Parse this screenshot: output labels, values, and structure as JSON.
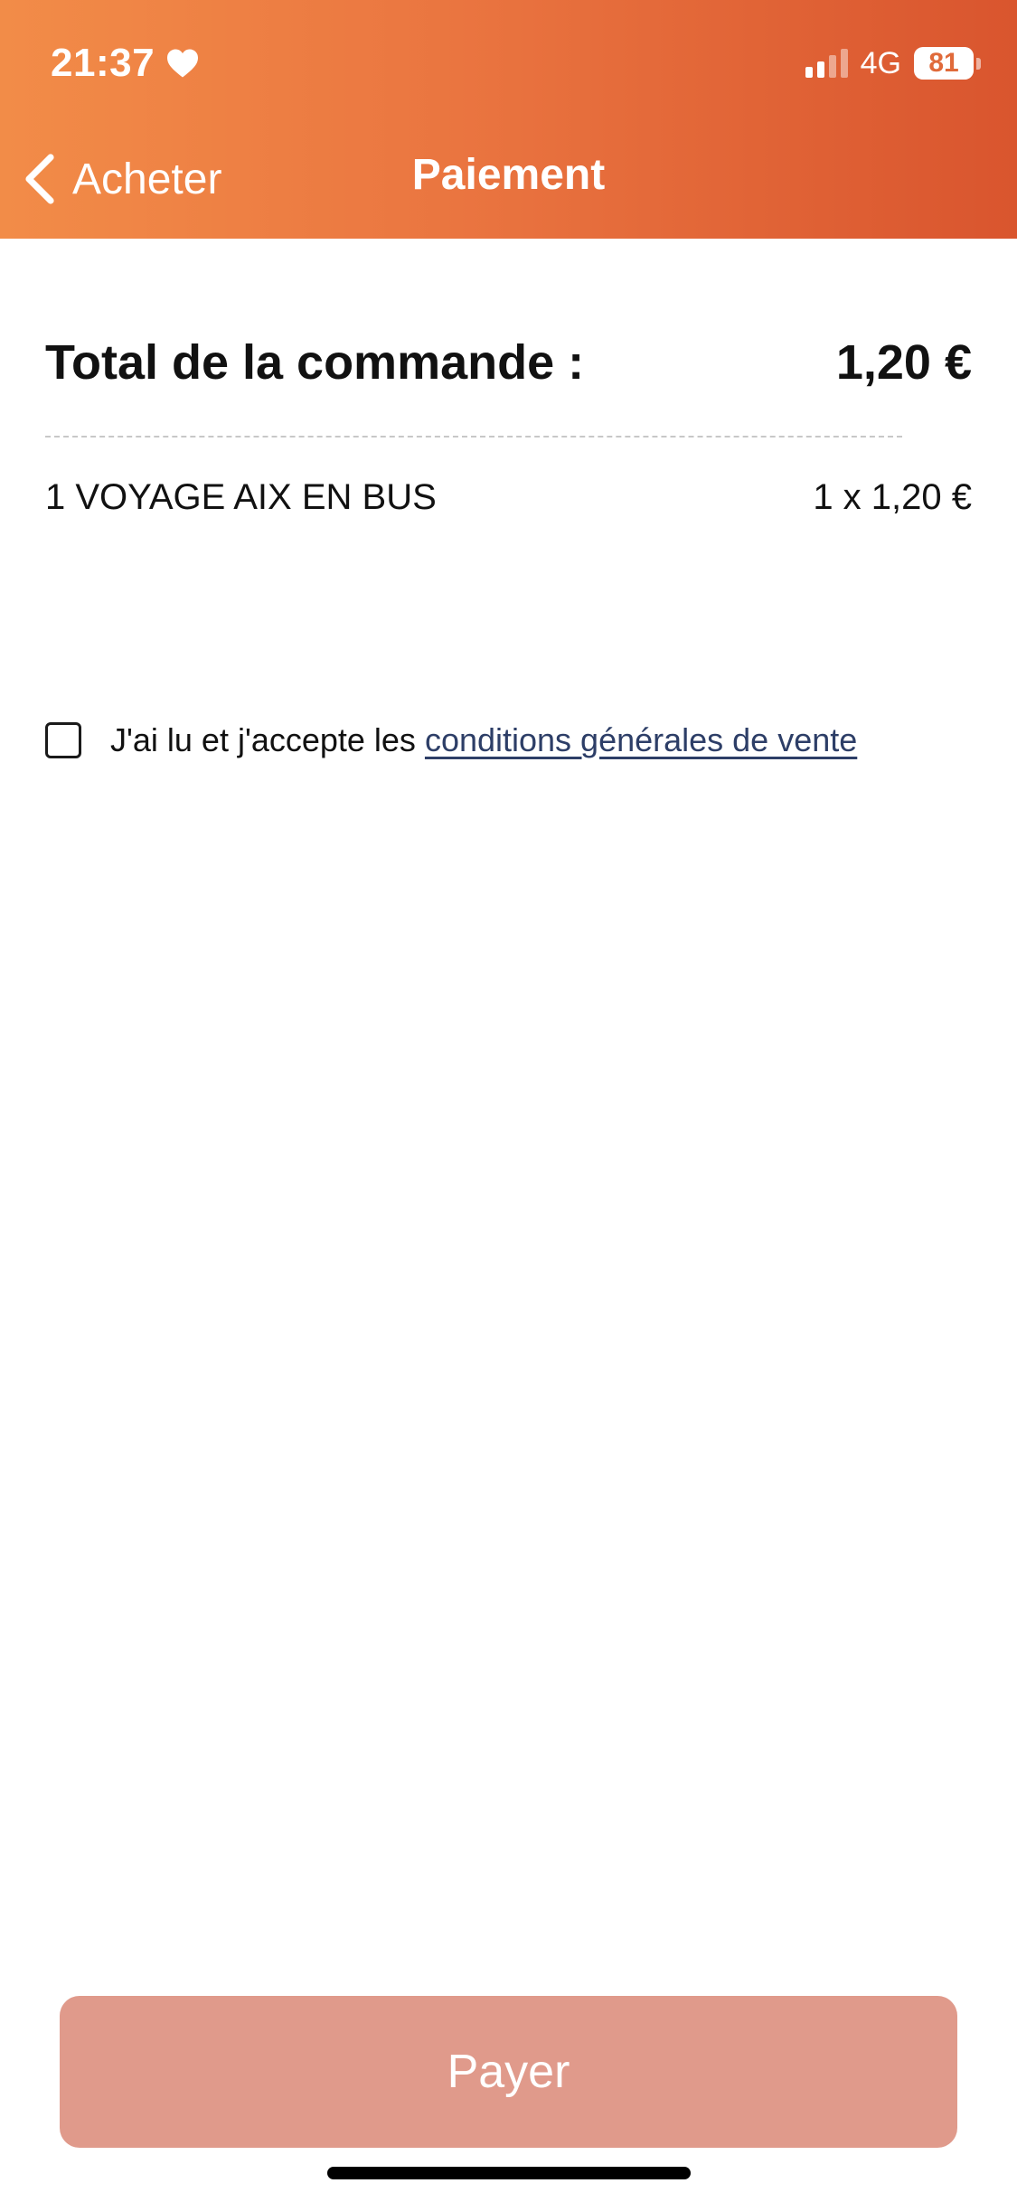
{
  "status_bar": {
    "time": "21:37",
    "heart_icon": "heart-icon",
    "network": "4G",
    "battery_level": "81",
    "signal_bars_active": 2,
    "signal_bars_total": 4
  },
  "nav": {
    "back_label": "Acheter",
    "back_icon": "chevron-left-icon",
    "title": "Paiement"
  },
  "order": {
    "total_label": "Total de la commande :",
    "total_amount": "1,20 €",
    "items": [
      {
        "name": "1 VOYAGE AIX EN BUS",
        "quantity_price": "1 x 1,20 €"
      }
    ]
  },
  "terms": {
    "checked": false,
    "prefix": "J'ai lu et j'accepte les ",
    "link_label": "conditions générales de vente"
  },
  "actions": {
    "pay_label": "Payer"
  },
  "colors": {
    "header_gradient_start": "#f28c48",
    "header_gradient_end": "#d9552e",
    "pay_button": "#e09a8b",
    "link": "#2d3e67"
  }
}
